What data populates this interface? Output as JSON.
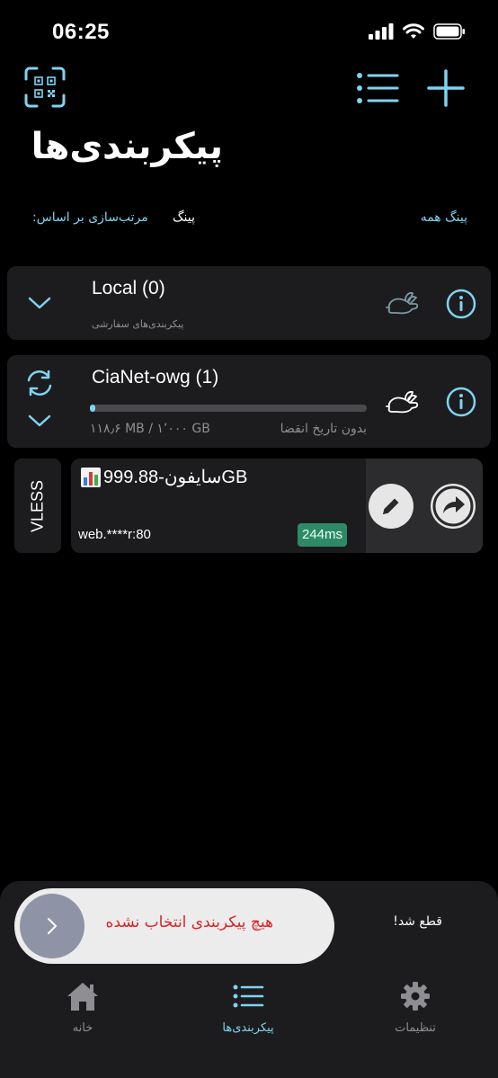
{
  "status_bar": {
    "time": "06:25"
  },
  "header": {
    "title": "پیکربندی‌ها",
    "qr_icon": "qr-scan-icon",
    "list_icon": "list-icon",
    "add_icon": "plus-icon"
  },
  "sort": {
    "label": "مرتب‌سازی بر اساس:",
    "value": "پینگ",
    "ping_all": "پینگ همه"
  },
  "groups": [
    {
      "title": "Local (0)",
      "subtitle": "پیکربندی‌های سفارشی"
    },
    {
      "title": "CiaNet-owg (1)",
      "usage": "۱۱۸٫۶ MB / ۱٬۰۰۰ GB",
      "expiry": "بدون تاریخ انقضا",
      "usage_fraction": 0.012
    }
  ],
  "server": {
    "protocol": "VLESS",
    "name": "سایفون-999.88GB",
    "address": "web.****r:80",
    "latency": "244ms"
  },
  "bottom": {
    "slider_text": "هیچ پیکربندی انتخاب نشده",
    "status": "قطع شد!"
  },
  "tabs": [
    {
      "label": "خانه",
      "icon": "home-icon"
    },
    {
      "label": "پیکربندی‌ها",
      "icon": "list-icon"
    },
    {
      "label": "تنظیمات",
      "icon": "gear-icon"
    }
  ],
  "colors": {
    "accent": "#7fd3f0",
    "latency_badge": "#2e8a66",
    "error": "#e02020",
    "card": "#1c1c1e"
  }
}
